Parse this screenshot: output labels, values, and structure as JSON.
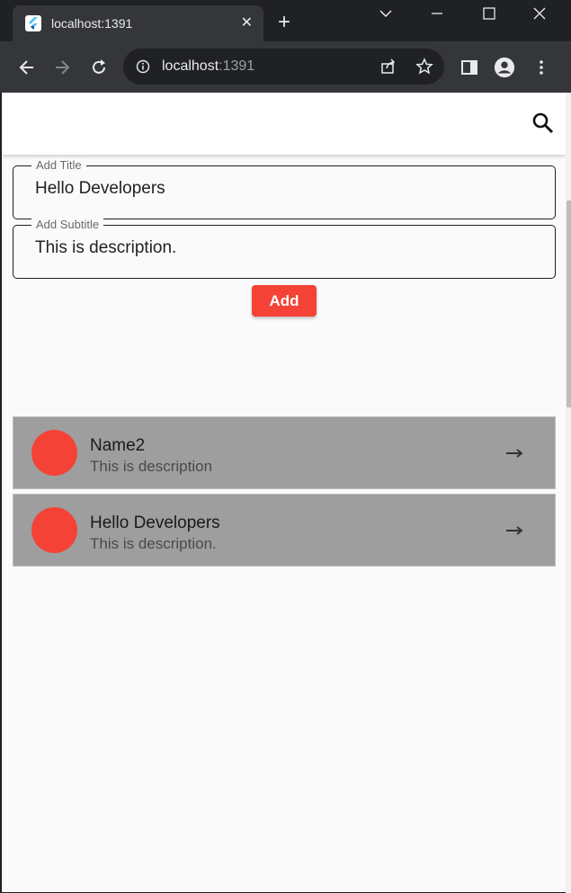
{
  "browser": {
    "tab": {
      "title": "localhost:1391",
      "close_glyph": "✕"
    },
    "new_tab_glyph": "+",
    "address": {
      "host": "localhost",
      "port": ":1391"
    }
  },
  "app": {
    "title_field": {
      "label": "Add Title",
      "value": "Hello Developers"
    },
    "subtitle_field": {
      "label": "Add Subtitle",
      "value": "This is description."
    },
    "add_button_label": "Add",
    "items": [
      {
        "title": "Name2",
        "subtitle": "This is description"
      },
      {
        "title": "Hello Developers",
        "subtitle": "This is description."
      }
    ],
    "colors": {
      "accent": "#f44336",
      "item_bg": "#9e9e9e",
      "page_bg": "#fafafa"
    }
  }
}
